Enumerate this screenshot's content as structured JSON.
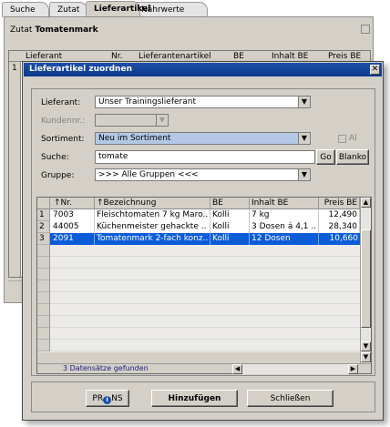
{
  "tabs": [
    {
      "label": "Suche"
    },
    {
      "label": "Zutat"
    },
    {
      "label": "Lieferartikel"
    },
    {
      "label": "Nährwerte"
    }
  ],
  "background": {
    "zutat_label": "Zutat",
    "zutat_value": "Tomatenmark",
    "grid_headers": [
      "Lieferant",
      "Nr.",
      "Lieferantenartikel",
      "BE",
      "Inhalt BE",
      "Preis BE"
    ],
    "row_number": "1"
  },
  "dialog": {
    "title": "Lieferartikel zuordnen",
    "close": "✕",
    "lieferant_label": "Lieferant:",
    "lieferant_value": "Unser Trainingslieferant",
    "kundennr_label": "Kundennr.:",
    "kundennr_value": "",
    "sortiment_label": "Sortiment:",
    "sortiment_value": "Neu im Sortiment",
    "alle_label": "Al",
    "suche_label": "Suche:",
    "suche_value": "tomate",
    "go_label": "Go",
    "blanko_label": "Blanko",
    "gruppe_label": "Gruppe:",
    "gruppe_value": ">>> Alle Gruppen <<<",
    "columns": [
      "↑Nr.",
      "↑Bezeichnung",
      "BE",
      "Inhalt BE",
      "Preis BE"
    ],
    "rows": [
      {
        "idx": "1",
        "nr": "7003",
        "bezeichnung": "Fleischtomaten 7 kg Maro..",
        "be": "Kolli",
        "inhalt": "7 kg",
        "preis": "12,490"
      },
      {
        "idx": "2",
        "nr": "44005",
        "bezeichnung": "Küchenmeister gehackte ..",
        "be": "Kolli",
        "inhalt": "3 Dosen á 4,1 ..",
        "preis": "28,340"
      },
      {
        "idx": "3",
        "nr": "2091",
        "bezeichnung": "Tomatenmark 2-fach konz..",
        "be": "Kolli",
        "inhalt": "12 Dosen",
        "preis": "10,660"
      }
    ],
    "selected_row": 3,
    "status": "3 Datensätze gefunden",
    "prins_label": "PR",
    "prins_icon_letter": "i",
    "prins_suffix": "NS",
    "hinzufuegen_label": "Hinzufügen",
    "schliessen_label": "Schließen"
  },
  "colors": {
    "titlebar": "#0c3a8c",
    "selection": "#0b5cd9",
    "window_face": "#d4d0c8"
  }
}
